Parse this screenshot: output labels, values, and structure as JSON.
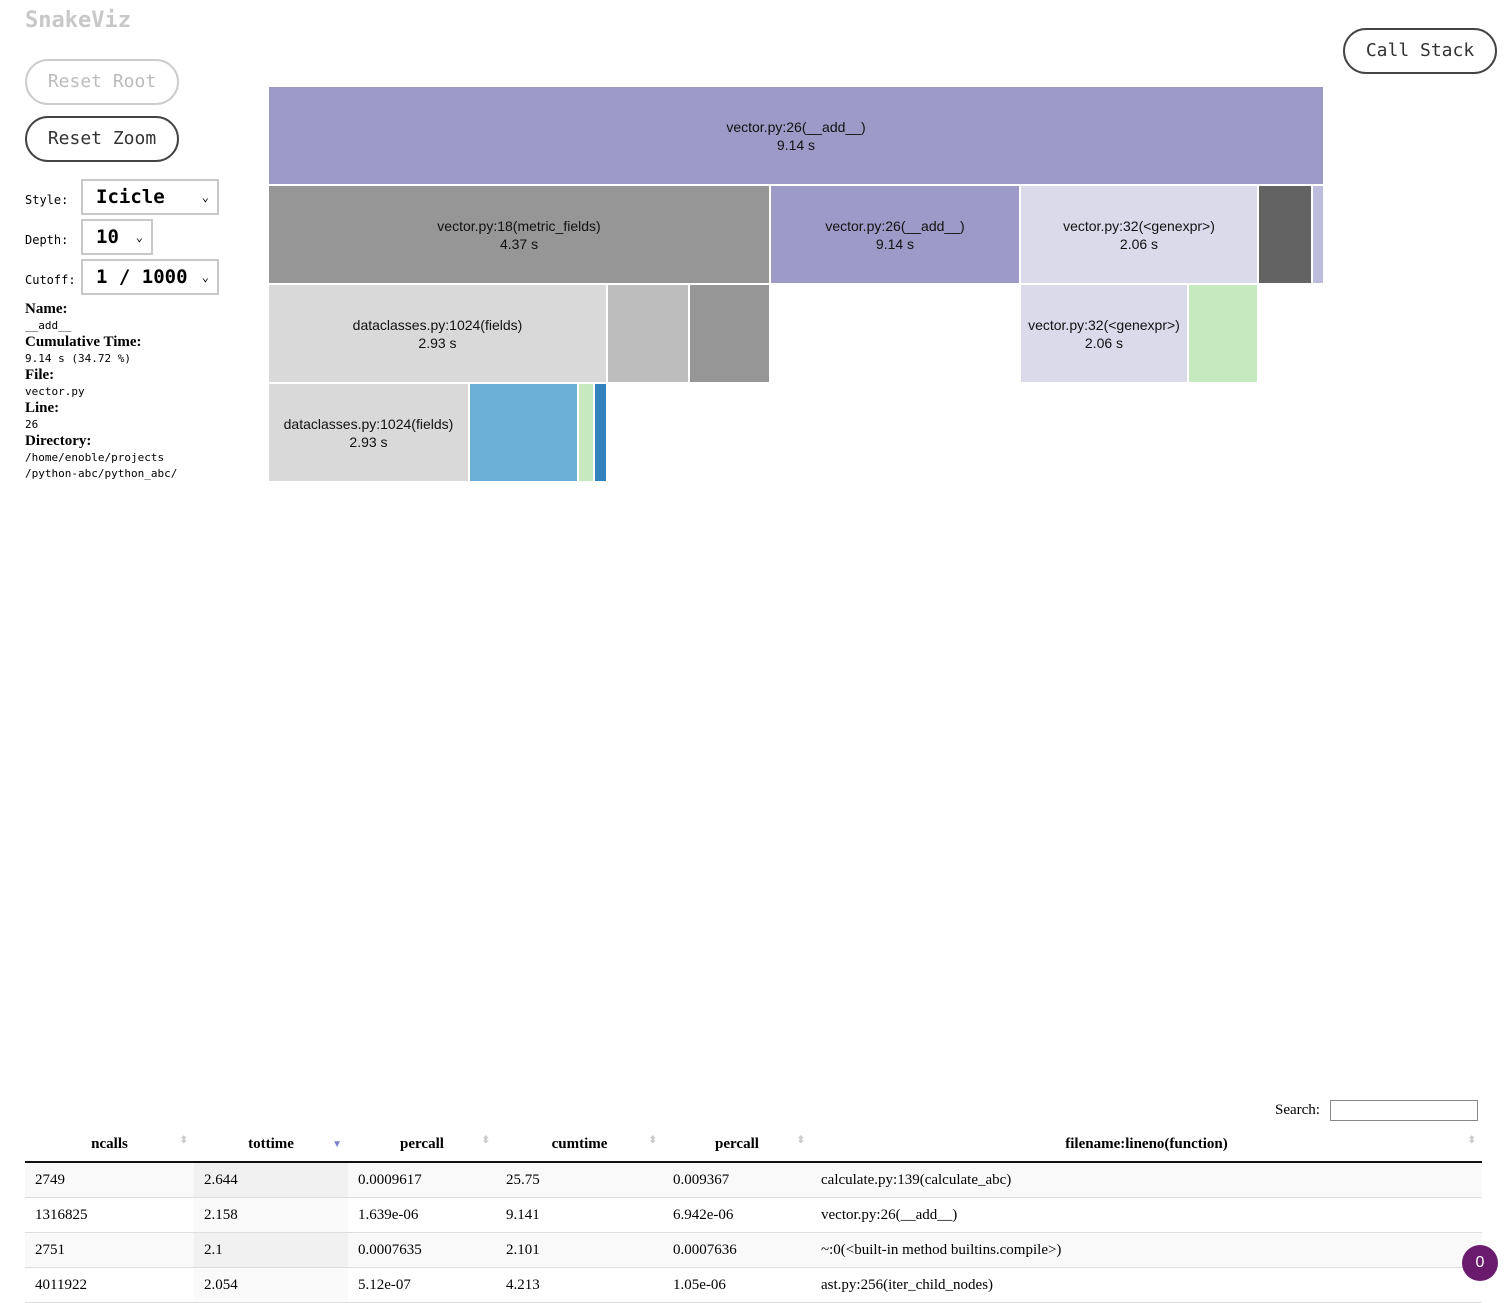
{
  "app": {
    "title": "SnakeViz"
  },
  "buttons": {
    "reset_root": "Reset Root",
    "reset_zoom": "Reset Zoom",
    "call_stack": "Call Stack"
  },
  "controls": {
    "style_label": "Style:",
    "style_value": "Icicle",
    "depth_label": "Depth:",
    "depth_value": "10",
    "cutoff_label": "Cutoff:",
    "cutoff_value": "1 / 1000",
    "chevron": "⌄"
  },
  "info": {
    "name_label": "Name:",
    "name": "__add__",
    "cumtime_label": "Cumulative Time:",
    "cumtime": "9.14 s (34.72 %)",
    "file_label": "File:",
    "file": "vector.py",
    "line_label": "Line:",
    "line": "26",
    "dir_label": "Directory:",
    "dir_1": "/home/enoble/projects",
    "dir_2": "/python-abc/python_abc/"
  },
  "icicle": {
    "nodes": [
      {
        "label": "vector.py:26(__add__)",
        "time": "9.14 s",
        "depth": 0,
        "start": 0,
        "end": 1,
        "color": "#9e9ac8"
      },
      {
        "label": "vector.py:18(metric_fields)",
        "time": "4.37 s",
        "depth": 1,
        "start": 0,
        "end": 0.4754,
        "color": "#969696"
      },
      {
        "label": "vector.py:26(__add__)",
        "time": "9.14 s",
        "depth": 1,
        "start": 0.4754,
        "end": 0.7121,
        "color": "#9e9ac8"
      },
      {
        "label": "vector.py:32(<genexpr>)",
        "time": "2.06 s",
        "depth": 1,
        "start": 0.7121,
        "end": 0.9375,
        "color": "#dadaeb"
      },
      {
        "label": "",
        "time": "",
        "depth": 1,
        "start": 0.9375,
        "end": 0.9886,
        "color": "#636363"
      },
      {
        "label": "",
        "time": "",
        "depth": 1,
        "start": 0.9886,
        "end": 1,
        "color": "#bcbddc"
      },
      {
        "label": "dataclasses.py:1024(fields)",
        "time": "2.93 s",
        "depth": 2,
        "start": 0,
        "end": 0.321,
        "color": "#d9d9d9"
      },
      {
        "label": "",
        "time": "",
        "depth": 2,
        "start": 0.321,
        "end": 0.3987,
        "color": "#bdbdbd"
      },
      {
        "label": "",
        "time": "",
        "depth": 2,
        "start": 0.3987,
        "end": 0.4754,
        "color": "#969696"
      },
      {
        "label": "vector.py:32(<genexpr>)",
        "time": "2.06 s",
        "depth": 2,
        "start": 0.7121,
        "end": 0.8712,
        "color": "#dadaeb"
      },
      {
        "label": "",
        "time": "",
        "depth": 2,
        "start": 0.8712,
        "end": 0.9375,
        "color": "#c7e9c0"
      },
      {
        "label": "dataclasses.py:1024(fields)",
        "time": "2.93 s",
        "depth": 3,
        "start": 0,
        "end": 0.1903,
        "color": "#d9d9d9"
      },
      {
        "label": "",
        "time": "",
        "depth": 3,
        "start": 0.1903,
        "end": 0.2936,
        "color": "#6baed6"
      },
      {
        "label": "",
        "time": "",
        "depth": 3,
        "start": 0.2936,
        "end": 0.3087,
        "color": "#c7e9c0"
      },
      {
        "label": "",
        "time": "",
        "depth": 3,
        "start": 0.3087,
        "end": 0.321,
        "color": "#3182bd"
      }
    ]
  },
  "table": {
    "search_label": "Search:",
    "search_value": "",
    "columns": [
      "ncalls",
      "tottime",
      "percall",
      "cumtime",
      "percall",
      "filename:lineno(function)"
    ],
    "sort_icon": "⬍",
    "sort_active_icon": "▼",
    "rows": [
      [
        "2749",
        "2.644",
        "0.0009617",
        "25.75",
        "0.009367",
        "calculate.py:139(calculate_abc)"
      ],
      [
        "1316825",
        "2.158",
        "1.639e-06",
        "9.141",
        "6.942e-06",
        "vector.py:26(__add__)"
      ],
      [
        "2751",
        "2.1",
        "0.0007635",
        "2.101",
        "0.0007636",
        "~:0(<built-in method builtins.compile>)"
      ],
      [
        "4011922",
        "2.054",
        "5.12e-07",
        "4.213",
        "1.05e-06",
        "ast.py:256(iter_child_nodes)"
      ]
    ]
  },
  "badge": {
    "count": "0"
  }
}
